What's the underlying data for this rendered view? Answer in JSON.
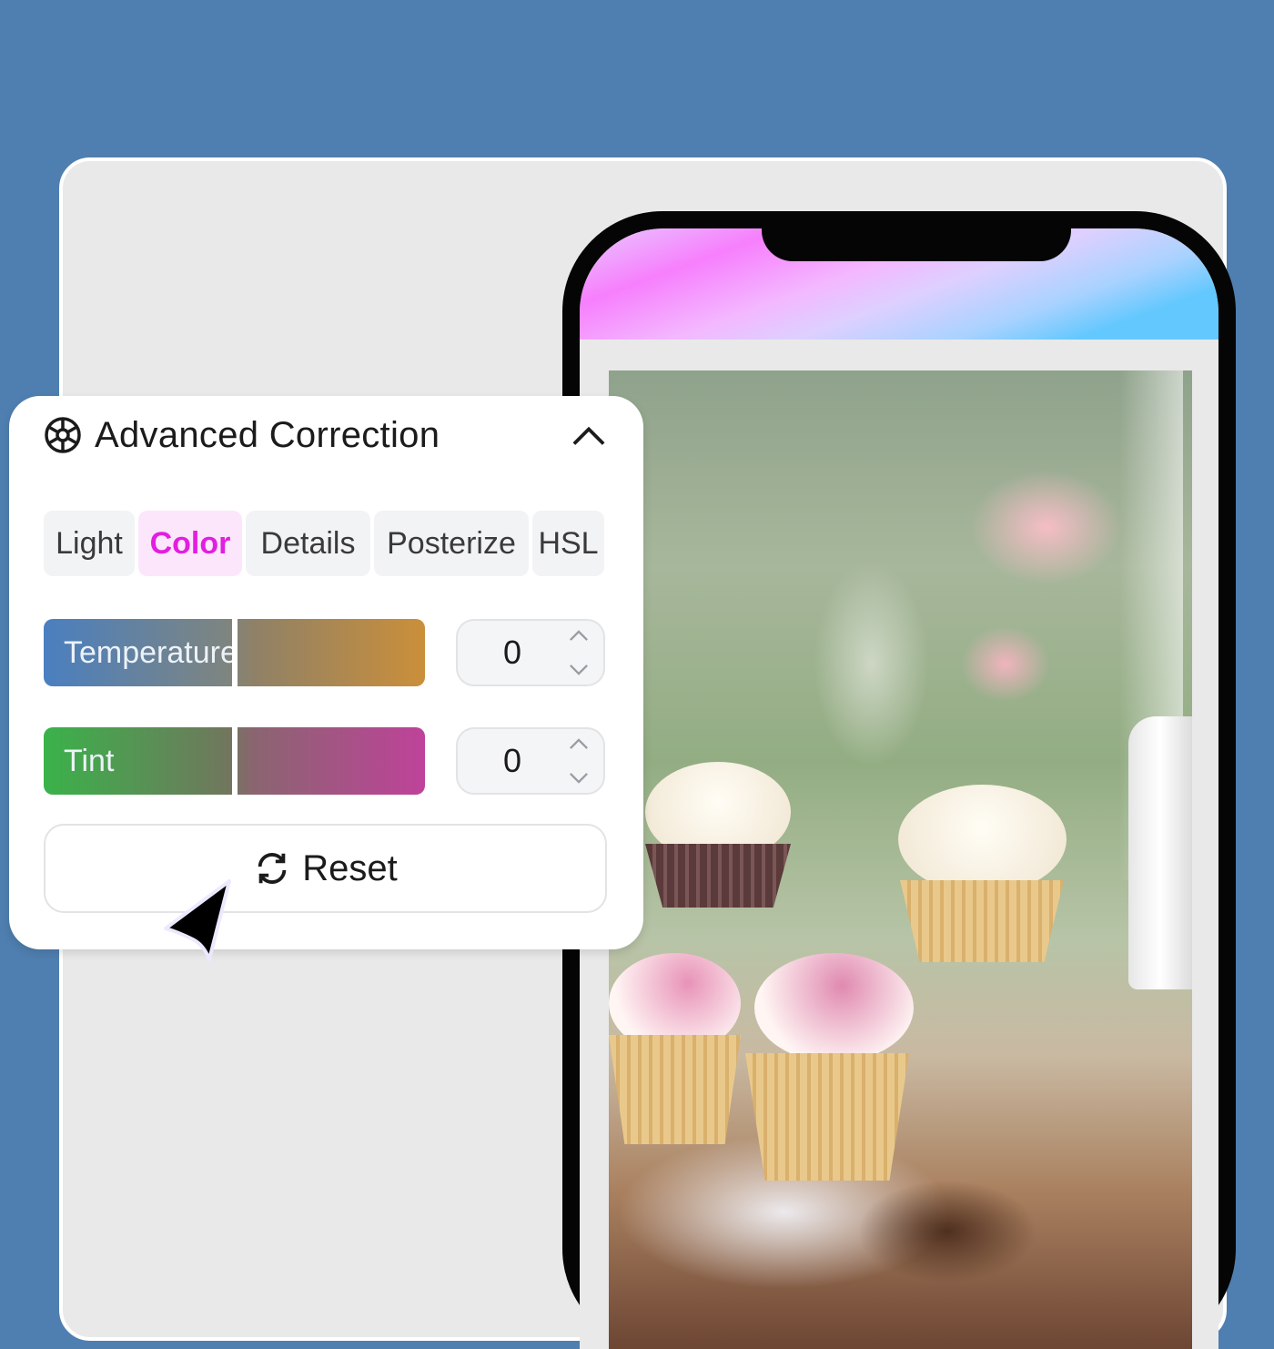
{
  "panel": {
    "title": "Advanced Correction",
    "icon": "aperture-icon",
    "collapse_icon": "chevron-up-icon",
    "tabs": [
      {
        "label": "Light",
        "active": false
      },
      {
        "label": "Color",
        "active": true
      },
      {
        "label": "Details",
        "active": false
      },
      {
        "label": "Posterize",
        "active": false
      },
      {
        "label": "HSL",
        "active": false
      }
    ],
    "sliders": [
      {
        "label": "Temperature",
        "value": "0",
        "position_fraction": 0.5
      },
      {
        "label": "Tint",
        "value": "0",
        "position_fraction": 0.5
      }
    ],
    "reset_label": "Reset",
    "reset_icon": "refresh-icon"
  },
  "colors": {
    "background": "#4f7fb0",
    "active_tab_text": "#e11fe0",
    "active_tab_bg": "#fce6fb"
  },
  "phone": {
    "photo_description": "cupcakes on glass stands and plate by window with pink flowers"
  },
  "cursor": "pointer-arrow"
}
